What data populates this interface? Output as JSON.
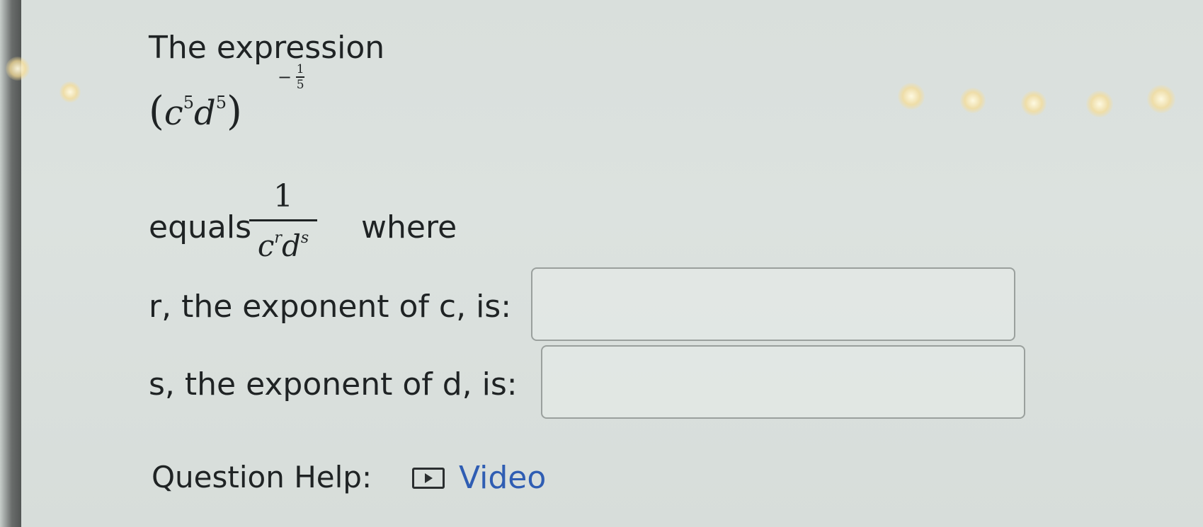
{
  "question": {
    "intro": "The expression",
    "expression": {
      "base_c": "c",
      "base_d": "d",
      "inner_exp_c": "5",
      "inner_exp_d": "5",
      "outer_sign": "−",
      "outer_num": "1",
      "outer_den": "5"
    },
    "equals_label": "equals",
    "fraction": {
      "numerator": "1",
      "den_c": "c",
      "den_r": "r",
      "den_d": "d",
      "den_s": "s"
    },
    "where_label": "where",
    "r_prompt": "r, the exponent of c, is:",
    "s_prompt": "s, the exponent of d, is:",
    "r_value": "",
    "s_value": ""
  },
  "help": {
    "label": "Question Help:",
    "video_label": "Video",
    "video_icon": "play-icon"
  },
  "colors": {
    "background": "#dce2df",
    "text": "#1f2324",
    "link": "#2f5db3",
    "input_border": "#9aa09d"
  }
}
